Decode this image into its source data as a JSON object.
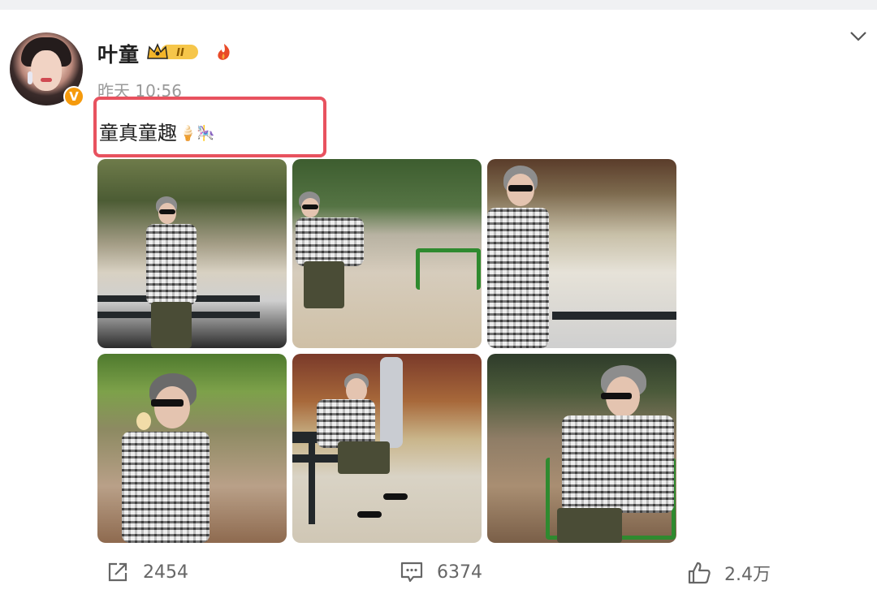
{
  "post": {
    "author": "叶童",
    "timestamp": "昨天 10:56",
    "text": "童真童趣",
    "text_emojis": "🍦🎠",
    "member_badge_level": "II"
  },
  "actions": {
    "repost_count": "2454",
    "comment_count": "6374",
    "like_count": "2.4万"
  },
  "colors": {
    "highlight_border": "#e8525f",
    "verified_badge": "#f59a0c",
    "muted_text": "#9a9a9a"
  },
  "icons": [
    "chevron-down-icon",
    "verified-badge-icon",
    "crown-badge-icon",
    "fire-icon",
    "repost-icon",
    "comment-icon",
    "like-icon"
  ]
}
